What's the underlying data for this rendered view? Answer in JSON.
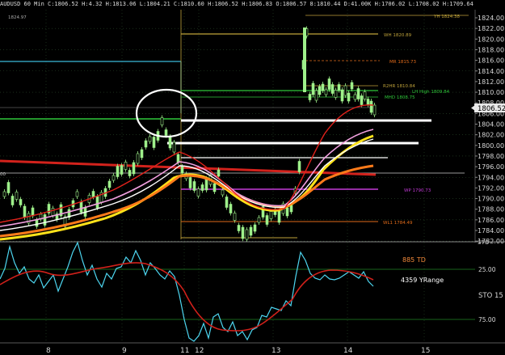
{
  "header": {
    "text": "AUDUSD 60 Min  C:1806.52  H:4.32  H:1813.06  L:1804.21  C:1810.60  H:1806.52  H:1806.83  O:1806.57  8:1810.44  D:41.00K  H:1706.02  L:1708.02  H:1709.64  L:1703.63  C:1703.02  L:4136  S:1813.88  12-07-22  H:1824.38",
    "corner_value": "1824.97"
  },
  "price_axis": {
    "ticks": [
      "1824.00",
      "1822.00",
      "1820.00",
      "1818.00",
      "1816.00",
      "1814.00",
      "1812.00",
      "1810.00",
      "1808.00",
      "1806.00",
      "1804.00",
      "1802.00",
      "1800.00",
      "1798.00",
      "1796.00",
      "1794.00",
      "1792.00",
      "1790.00",
      "1788.00",
      "1786.00",
      "1784.00",
      "1782.00"
    ],
    "current": "1806.52",
    "bottom_tag": "STO"
  },
  "indicator_axis": {
    "ticks": [
      "25.00",
      "75.00"
    ],
    "tag": "STO  15"
  },
  "time_axis": {
    "ticks": [
      "8",
      "9",
      "11",
      "12",
      "13",
      "14",
      "15"
    ]
  },
  "levels": {
    "yh": "YH 1824.38",
    "wh": "WH 1820.89",
    "mr": "MR 1815.73",
    "r2hr": "R2HR 1810.84",
    "mhb": "MHD 1808.75",
    "lh_high": "LH High 1809.84",
    "wp": "WP 1790.73",
    "wl": "WL1 1784.49",
    "left_value": "00"
  },
  "annotations": {
    "td": "885 TD",
    "yrange": "4359 YRange"
  },
  "colors": {
    "background": "#000000",
    "candle": "#9ef08a",
    "ema_red": "#e0211b",
    "ema_pink": "#f2a0e0",
    "ema_white": "#ffffff",
    "ema_orange": "#ff7b1a",
    "ema_yellow": "#ffe21a",
    "stoch_cyan": "#4dd6f0",
    "stoch_red": "#d0201a",
    "level_olive": "#bfa23a",
    "level_green": "#2fc83a",
    "level_magenta": "#c43ad8",
    "level_orange": "#e06a1a",
    "level_cyan": "#3ab8d8"
  }
}
